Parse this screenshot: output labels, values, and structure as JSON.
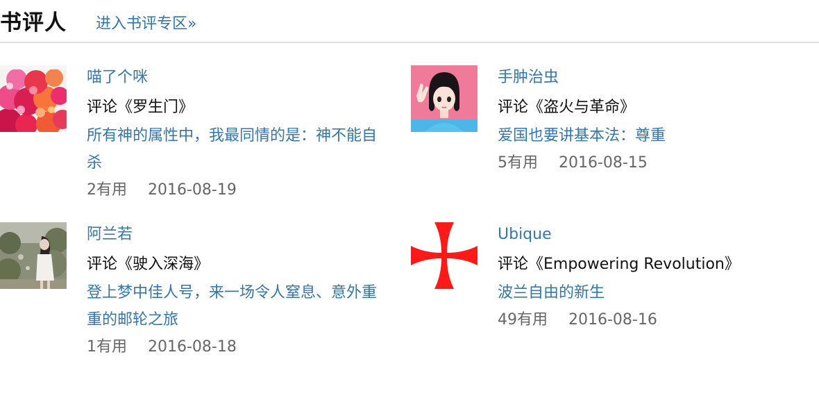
{
  "section": {
    "title": "书评人",
    "more_link": "进入书评专区»"
  },
  "reviews": [
    {
      "user": "喵了个咪",
      "book": "评论《罗生门》",
      "title": "所有神的属性中，我最同情的是：神不能自杀",
      "useful": "2有用",
      "date": "2016-08-19",
      "avatar": "bouquet-photo-avatar"
    },
    {
      "user": "手肿治虫",
      "book": "评论《盗火与革命》",
      "title": "爱国也要讲基本法：尊重",
      "useful": "5有用",
      "date": "2016-08-15",
      "avatar": "anime-girl-avatar"
    },
    {
      "user": "阿兰若",
      "book": "评论《驶入深海》",
      "title": "登上梦中佳人号，来一场令人窒息、意外重重的邮轮之旅",
      "useful": "1有用",
      "date": "2016-08-18",
      "avatar": "woman-in-garden-avatar"
    },
    {
      "user": "Ubique",
      "book": "评论《Empowering Revolution》",
      "title": "波兰自由的新生",
      "useful": "49有用",
      "date": "2016-08-16",
      "avatar": "red-cross-avatar"
    }
  ],
  "colors": {
    "link": "#3377aa",
    "text": "#111111",
    "meta": "#666666",
    "divider": "#e2e2e2",
    "cross_red": "#ff1a1a"
  }
}
